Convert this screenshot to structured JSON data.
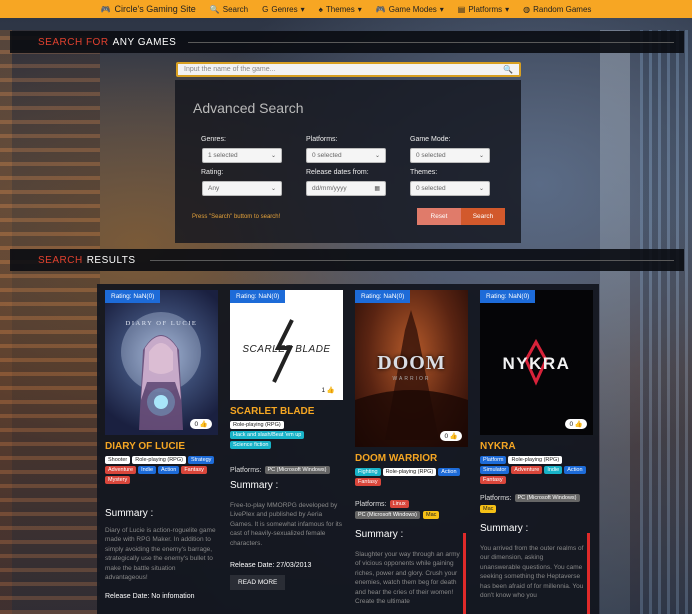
{
  "nav": {
    "brand": "Circle's Gaming Site",
    "items": [
      "Search",
      "Genres",
      "Themes",
      "Game Modes",
      "Platforms",
      "Random Games"
    ]
  },
  "search_section": {
    "prefix": "SEARCH FOR",
    "title": "ANY GAMES"
  },
  "search": {
    "placeholder": "Input the name of the game..."
  },
  "advanced": {
    "title": "Advanced Search",
    "genres_label": "Genres:",
    "genres_value": "1 selected",
    "platforms_label": "Platforms:",
    "platforms_value": "0 selected",
    "gamemode_label": "Game Mode:",
    "gamemode_value": "0 selected",
    "rating_label": "Rating:",
    "rating_value": "Any",
    "release_label": "Release dates from:",
    "release_value": "dd/mm/yyyy",
    "themes_label": "Themes:",
    "themes_value": "0 selected",
    "hint": "Press \"Search\" buttom to search!",
    "reset_label": "Reset",
    "search_label": "Search"
  },
  "results_section": {
    "prefix": "SEARCH",
    "title": "RESULTS"
  },
  "games": [
    {
      "rating": "Rating: NaN(0)",
      "likes": "0",
      "cover_text": "DIARY OF LUCIE",
      "title": "DIARY OF LUCIE",
      "tags": [
        {
          "text": "Shooter",
          "style": "w"
        },
        {
          "text": "Role-playing (RPG)",
          "style": "w"
        },
        {
          "text": "Strategy",
          "style": "b"
        },
        {
          "text": "Adventure",
          "style": "r"
        },
        {
          "text": "Indie",
          "style": "b"
        },
        {
          "text": "Action",
          "style": "b"
        },
        {
          "text": "Fantasy",
          "style": "r"
        },
        {
          "text": "Mystery",
          "style": "r"
        }
      ],
      "platforms_label": "",
      "platforms": [],
      "summary_label": "Summary :",
      "summary": "Diary of Lucie is action-roguelite game made with RPG Maker. In addition to simply avoiding the enemy's barrage, strategically use the enemy's bullet to make the battle situation advantageous!",
      "release": "Release Date:  No infomation"
    },
    {
      "rating": "Rating: NaN(0)",
      "likes": "1",
      "cover_text": "SCARLET BLADE",
      "title": "SCARLET BLADE",
      "tags": [
        {
          "text": "Role-playing (RPG)",
          "style": "w"
        },
        {
          "text": "Hack and slash/Beat 'em up",
          "style": "c"
        },
        {
          "text": "Science fiction",
          "style": "c"
        }
      ],
      "platforms_label": "Platforms:",
      "platforms": [
        {
          "text": "PC (Microsoft Windows)",
          "style": "g"
        }
      ],
      "summary_label": "Summary :",
      "summary": "Free-to-play MMORPG developed by LivePlex and published by Aeria Games. It is somewhat infamous for its cast of heavily-sexualized female characters.",
      "release": "Release Date:  27/03/2013",
      "readmore": "READ MORE"
    },
    {
      "rating": "Rating: NaN(0)",
      "likes": "0",
      "cover_text": "DOOM",
      "cover_sub": "WARRIOR",
      "title": "DOOM WARRIOR",
      "tags": [
        {
          "text": "Fighting",
          "style": "c"
        },
        {
          "text": "Role-playing (RPG)",
          "style": "w"
        },
        {
          "text": "Action",
          "style": "b"
        },
        {
          "text": "Fantasy",
          "style": "r"
        }
      ],
      "platforms_label": "Platforms:",
      "platforms": [
        {
          "text": "Linux",
          "style": "r"
        },
        {
          "text": "PC (Microsoft Windows)",
          "style": "g"
        },
        {
          "text": "Mac",
          "style": "y"
        }
      ],
      "summary_label": "Summary :",
      "summary": "Slaughter your way through an army of vicious opponents while gaining riches, power and glory. Crush your enemies, watch them beg for death and hear the cries of their women! Create the ultimate"
    },
    {
      "rating": "Rating: NaN(0)",
      "likes": "0",
      "cover_text": "NYKRA",
      "title": "NYKRA",
      "tags": [
        {
          "text": "Platform",
          "style": "b"
        },
        {
          "text": "Role-playing (RPG)",
          "style": "w"
        },
        {
          "text": "Simulator",
          "style": "b"
        },
        {
          "text": "Adventure",
          "style": "r"
        },
        {
          "text": "Indie",
          "style": "c"
        },
        {
          "text": "Action",
          "style": "b"
        },
        {
          "text": "Fantasy",
          "style": "r"
        }
      ],
      "platforms_label": "Platforms:",
      "platforms": [
        {
          "text": "PC (Microsoft Windows)",
          "style": "g"
        },
        {
          "text": "Mac",
          "style": "y"
        }
      ],
      "summary_label": "Summary :",
      "summary": "You arrived from the outer realms of our dimension, asking unanswerable questions. You came seeking something the Heptaverse has been afraid of for millennia. You don't know who you"
    }
  ],
  "colors": {
    "nav": "#f7a623",
    "accent_red": "#e0412f",
    "title_orange": "#f5a623",
    "rating_blue": "#1d6bd8"
  }
}
